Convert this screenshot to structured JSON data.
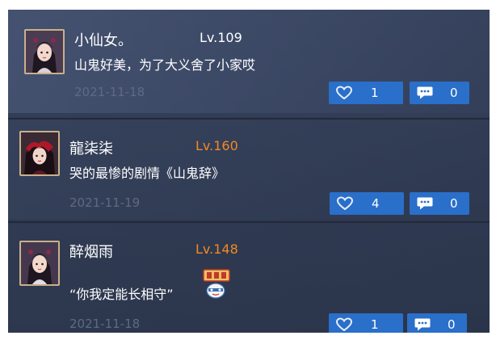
{
  "comments": [
    {
      "name": "小仙女。",
      "level": "Lv.109",
      "level_color": "#ffffff",
      "text": "山鬼好美，为了大义舍了小家哎",
      "date": "2021-11-18",
      "likes": "1",
      "replies": "0"
    },
    {
      "name": "龍柒柒",
      "level": "Lv.160",
      "level_color": "#f08a24",
      "text": "哭的最惨的剧情《山鬼辞》",
      "date": "2021-11-19",
      "likes": "4",
      "replies": "0"
    },
    {
      "name": "醉烟雨",
      "level": "Lv.148",
      "level_color": "#f08a24",
      "text": "“你我定能长相守”",
      "date": "2021-11-18",
      "likes": "1",
      "replies": "0"
    }
  ],
  "icons": {
    "like": "heart-icon",
    "reply": "speech-bubble-icon",
    "emoji": "emoji-sticker-icon",
    "avatar": "character-avatar"
  },
  "colors": {
    "button_bg": "#2a6fc9",
    "date_text": "#5e6a85"
  }
}
